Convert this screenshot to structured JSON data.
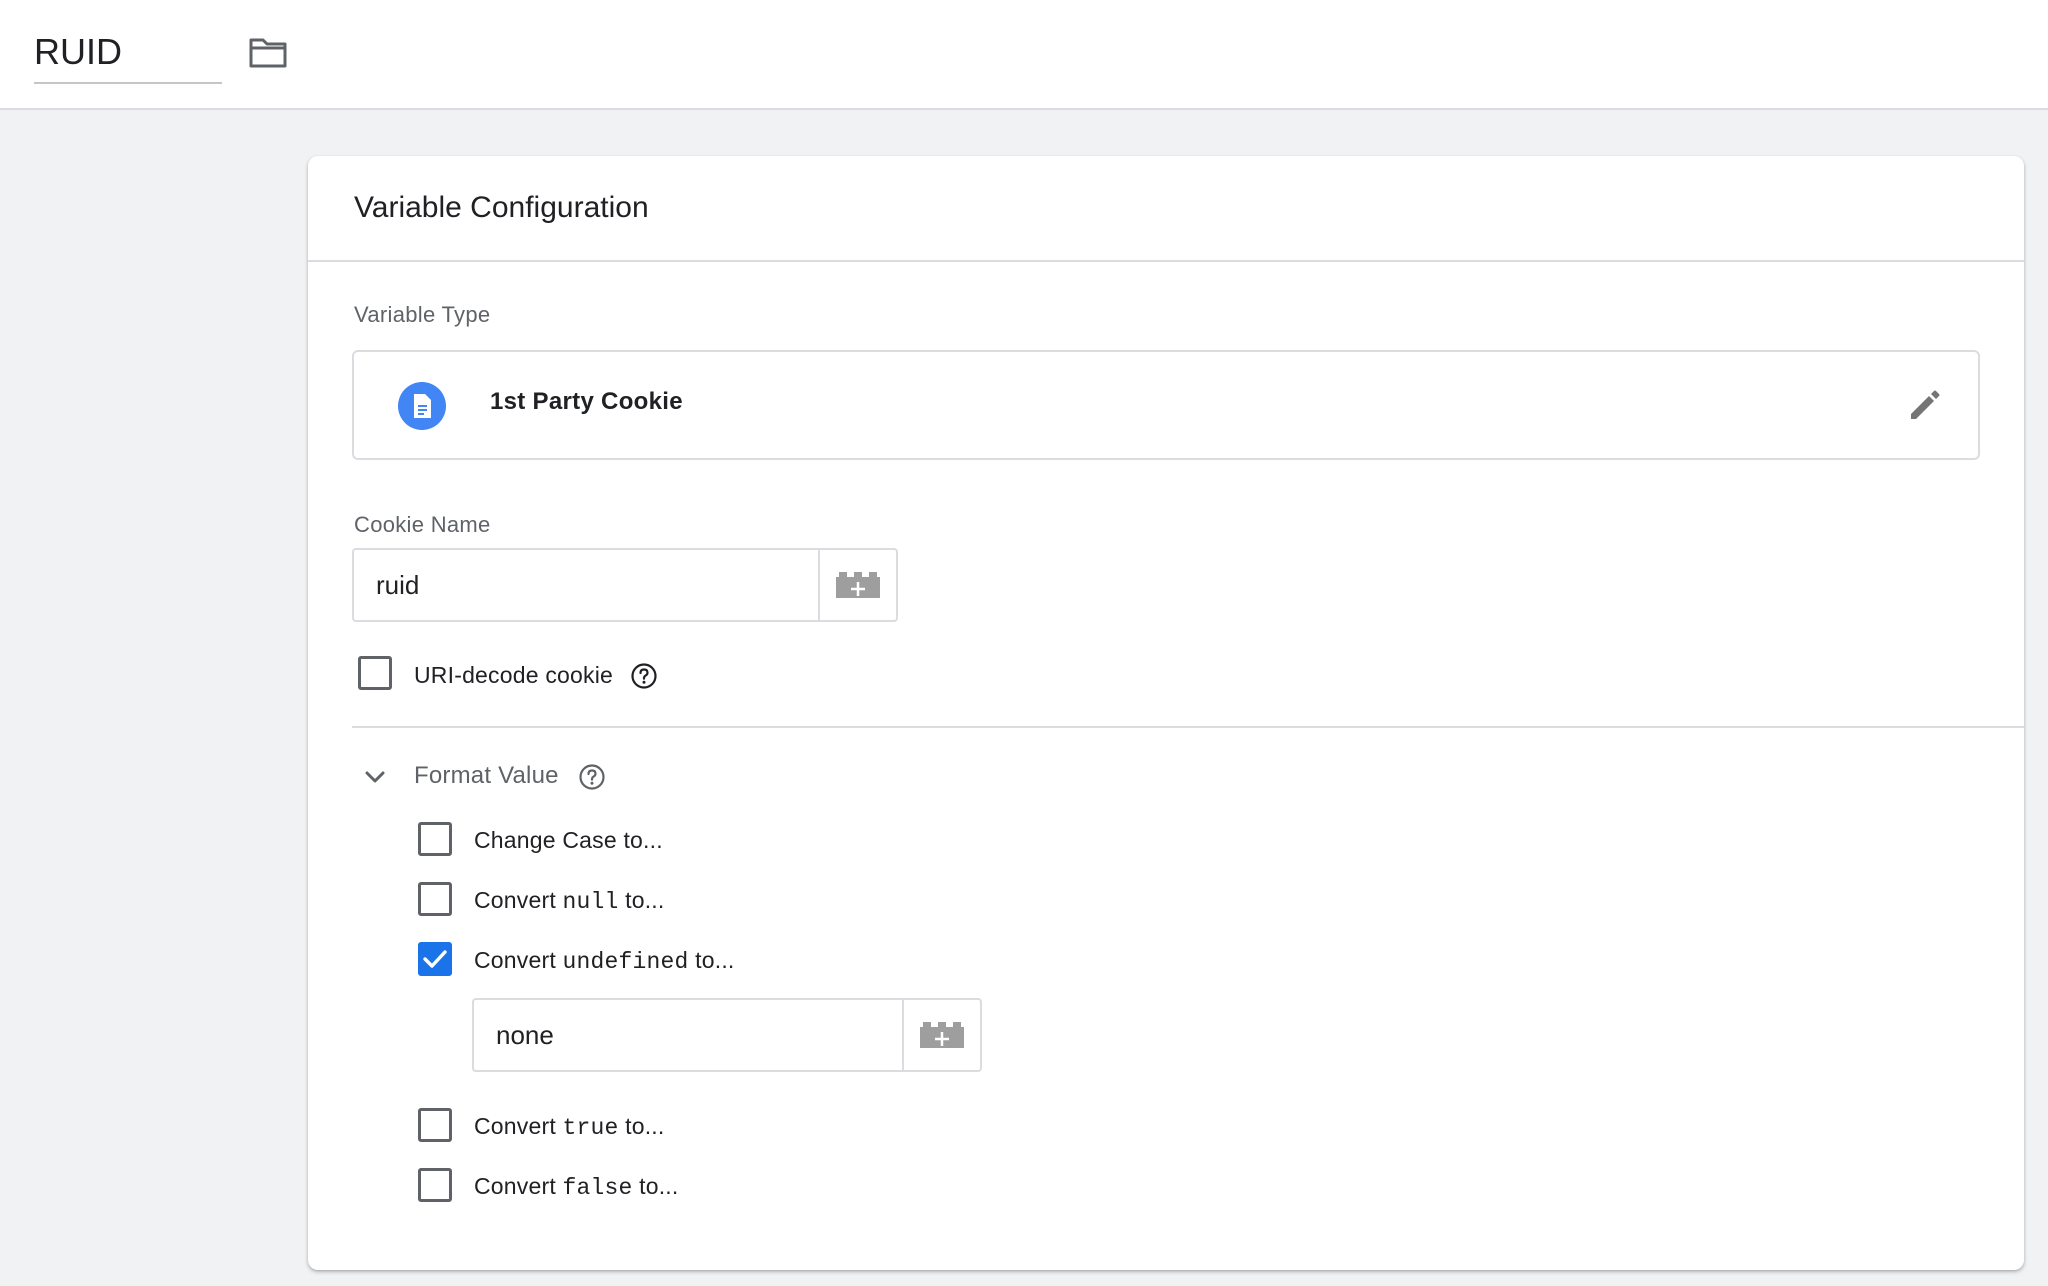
{
  "header": {
    "variable_name": "RUID",
    "folder_icon": "folder-icon"
  },
  "card": {
    "title": "Variable Configuration",
    "variable_type": {
      "label": "Variable Type",
      "name": "1st Party Cookie",
      "icon": "document-icon",
      "icon_color": "#4285f4",
      "edit_icon": "pencil-icon"
    },
    "cookie_name": {
      "label": "Cookie Name",
      "value": "ruid",
      "variable_icon": "lego-block-icon"
    },
    "uri_decode": {
      "label": "URI-decode cookie",
      "checked": false,
      "help_icon": "help-icon"
    },
    "format_value": {
      "label": "Format Value",
      "expanded": true,
      "help_icon": "help-icon",
      "options": [
        {
          "prefix": "Change Case to...",
          "code": "",
          "suffix": "",
          "checked": false
        },
        {
          "prefix": "Convert ",
          "code": "null",
          "suffix": " to...",
          "checked": false
        },
        {
          "prefix": "Convert ",
          "code": "undefined",
          "suffix": " to...",
          "checked": true
        },
        {
          "prefix": "Convert ",
          "code": "true",
          "suffix": " to...",
          "checked": false
        },
        {
          "prefix": "Convert ",
          "code": "false",
          "suffix": " to...",
          "checked": false
        }
      ],
      "undefined_value": "none"
    }
  },
  "colors": {
    "accent": "#1a73e8",
    "border": "#dadce0",
    "background": "#f1f2f4"
  }
}
